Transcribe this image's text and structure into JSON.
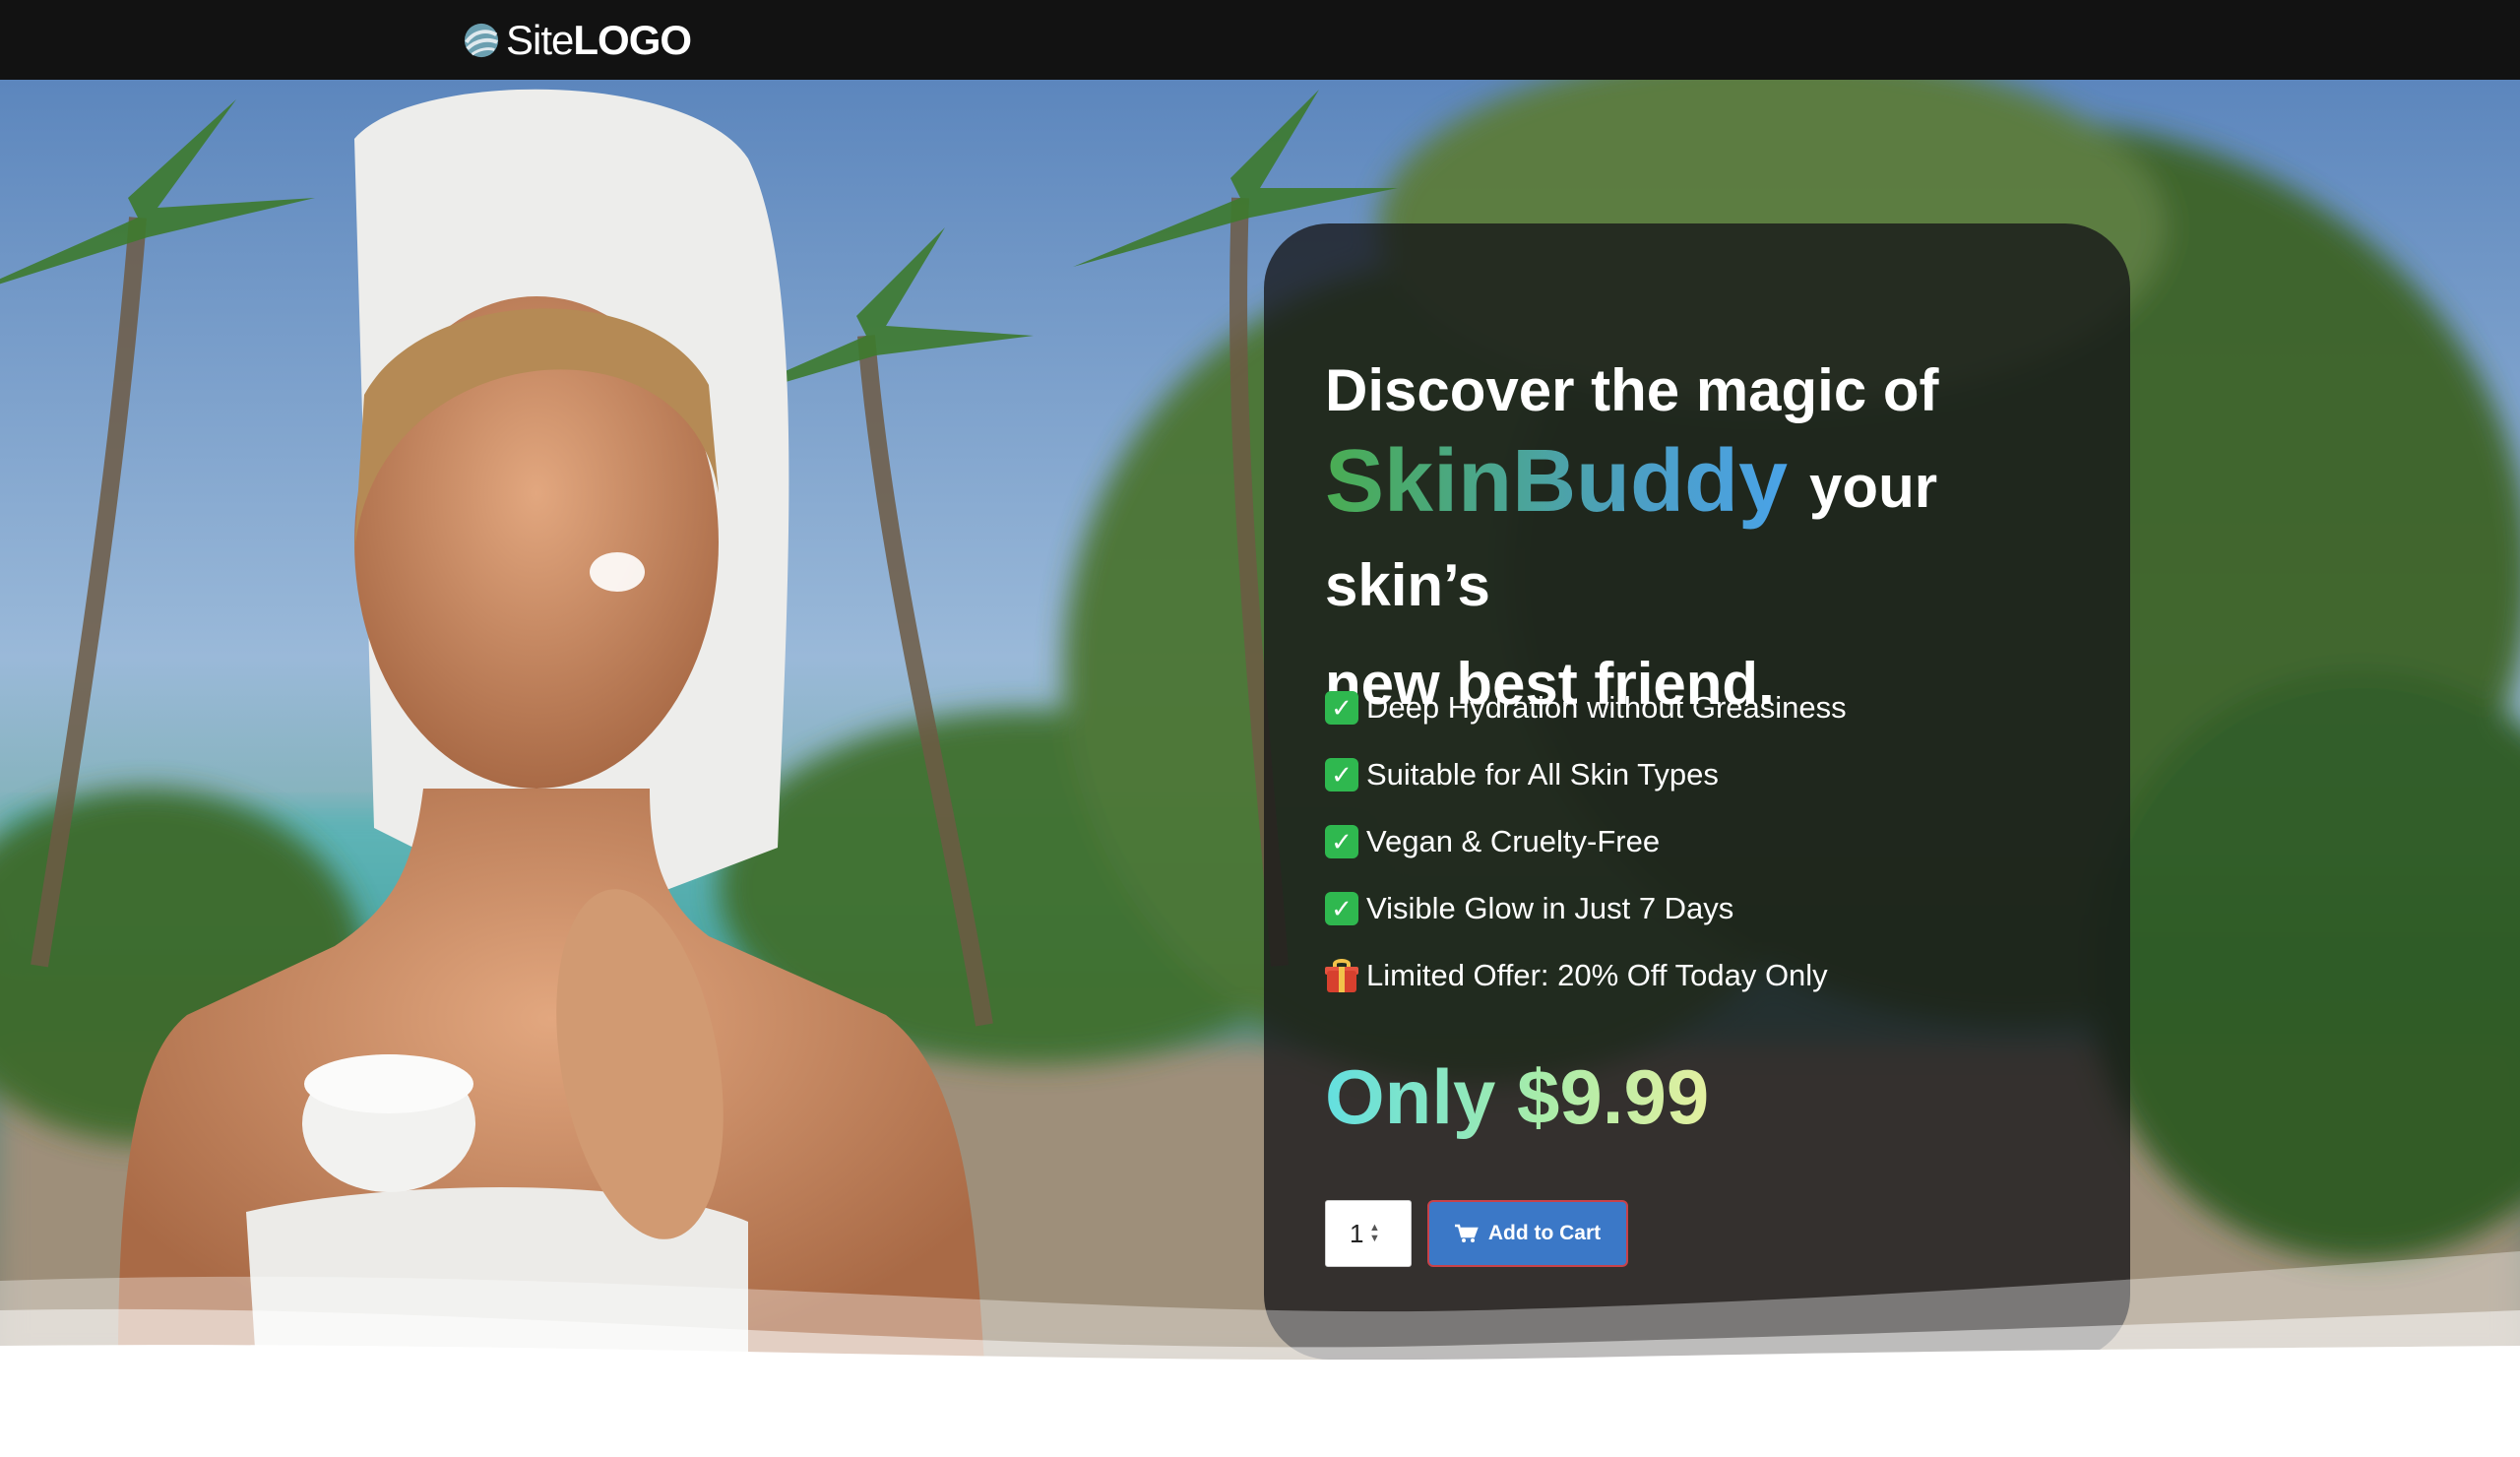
{
  "header": {
    "logo_text_light": "Site",
    "logo_text_bold": "LOGO",
    "logo_icon": "globe-swirl-icon"
  },
  "hero": {
    "headline_line1": "Discover the magic of",
    "brand_name": "SkinBuddy",
    "headline_after_brand": "your skin’s",
    "headline_line3": "new best friend.",
    "features": [
      {
        "icon": "check-icon",
        "text": "Deep Hydration without Greasiness"
      },
      {
        "icon": "check-icon",
        "text": "Suitable for All Skin Types"
      },
      {
        "icon": "check-icon",
        "text": "Vegan & Cruelty-Free"
      },
      {
        "icon": "check-icon",
        "text": "Visible Glow in Just 7 Days"
      },
      {
        "icon": "gift-icon",
        "text": "Limited Offer: 20% Off Today Only"
      }
    ],
    "price_text": "Only $9.99",
    "quantity_value": "1",
    "add_to_cart_label": "Add to Cart",
    "cart_icon": "cart-icon"
  },
  "colors": {
    "topbar": "#121212",
    "brand_gradient_start": "#4aad52",
    "brand_gradient_end": "#4aa3e8",
    "price_gradient_start": "#63dfe0",
    "price_gradient_end": "#e4f0a0",
    "button": "#3b78c7",
    "button_border": "#c8424a",
    "check": "#2fb84f"
  }
}
